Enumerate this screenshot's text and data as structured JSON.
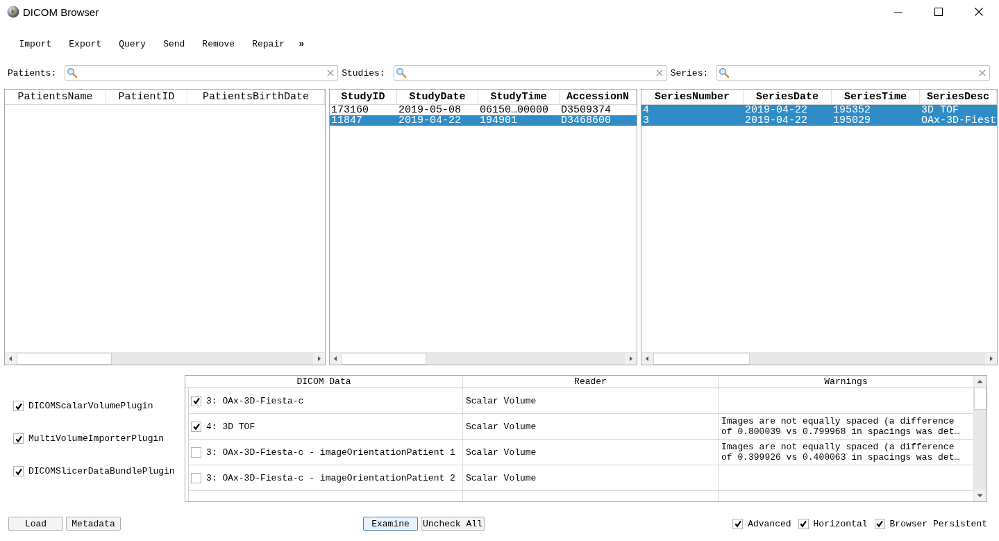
{
  "window": {
    "title": "DICOM Browser"
  },
  "toolbar": {
    "actions": [
      "Import",
      "Export",
      "Query",
      "Send",
      "Remove",
      "Repair"
    ],
    "overflow": "»"
  },
  "filters": [
    {
      "label": "Patients:"
    },
    {
      "label": "Studies:"
    },
    {
      "label": "Series:"
    }
  ],
  "patients_table": {
    "bold_headers": false,
    "columns": [
      "PatientsName",
      "PatientID",
      "PatientsBirthDate"
    ]
  },
  "studies_table": {
    "bold_headers": true,
    "columns": [
      "StudyID",
      "StudyDate",
      "StudyTime",
      "AccessionN"
    ],
    "rows": [
      {
        "selected": false,
        "cells": [
          "173160",
          "2019-05-08",
          "06150…00000",
          "D3509374"
        ]
      },
      {
        "selected": true,
        "cells": [
          "11847",
          "2019-04-22",
          "194901",
          "D3468600"
        ]
      }
    ]
  },
  "series_table": {
    "bold_headers": true,
    "columns": [
      "SeriesNumber",
      "SeriesDate",
      "SeriesTime",
      "SeriesDesc"
    ],
    "rows": [
      {
        "selected": true,
        "cells": [
          "4",
          "2019-04-22",
          "195352",
          "3D TOF"
        ]
      },
      {
        "selected": true,
        "cells": [
          "3",
          "2019-04-22",
          "195029",
          "OAx-3D-Fiest"
        ]
      }
    ]
  },
  "plugins": [
    {
      "label": "DICOMScalarVolumePlugin",
      "checked": true
    },
    {
      "label": "MultiVolumeImporterPlugin",
      "checked": true
    },
    {
      "label": "DICOMSlicerDataBundlePlugin",
      "checked": true
    }
  ],
  "loadables_table": {
    "columns": [
      "DICOM Data",
      "Reader",
      "Warnings"
    ],
    "rows": [
      {
        "checked": true,
        "name": "3: OAx-3D-Fiesta-c",
        "reader": "Scalar Volume"
      },
      {
        "checked": true,
        "name": "4: 3D TOF",
        "reader": "Scalar Volume",
        "warning": "Images are not equally spaced (a difference of 0.800039 vs 0.799968 in spacings was det…"
      },
      {
        "checked": false,
        "name": "3: OAx-3D-Fiesta-c - imageOrientationPatient 1",
        "reader": "Scalar Volume",
        "warning": "Images are not equally spaced (a difference of 0.399926 vs 0.400063 in spacings was det…"
      },
      {
        "checked": false,
        "name": "3: OAx-3D-Fiesta-c - imageOrientationPatient 2",
        "reader": "Scalar Volume"
      }
    ]
  },
  "load_actions": [
    {
      "label": "Load",
      "focused": false
    },
    {
      "label": "Metadata",
      "focused": false
    }
  ],
  "examine_actions": [
    {
      "label": "Examine",
      "focused": true
    },
    {
      "label": "Uncheck All",
      "focused": false
    }
  ],
  "options": [
    {
      "label": "Advanced",
      "checked": true
    },
    {
      "label": "Horizontal",
      "checked": true
    },
    {
      "label": "Browser Persistent",
      "checked": true
    }
  ]
}
